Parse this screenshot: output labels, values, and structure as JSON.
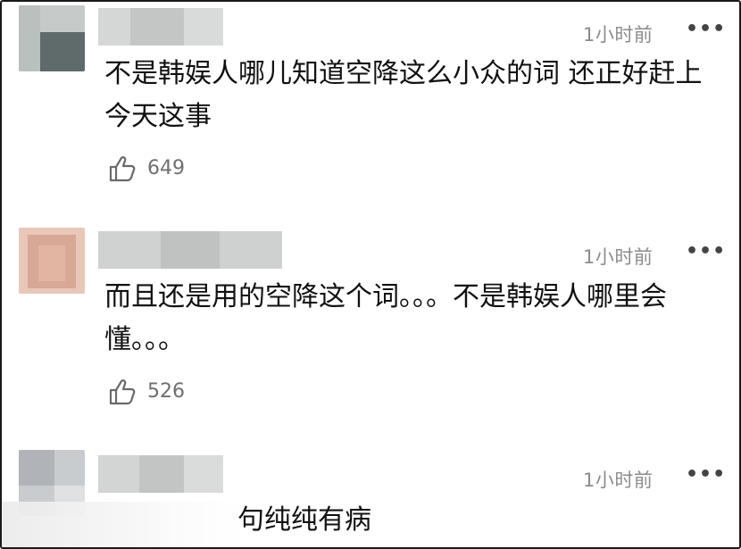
{
  "comments": [
    {
      "time": "1小时前",
      "more": "•••",
      "text": "不是韩娱人哪儿知道空降这么小众的词 还正好赶上今天这事",
      "likes": "649"
    },
    {
      "time": "1小时前",
      "more": "•••",
      "text": "而且还是用的空降这个词。。。不是韩娱人哪里会懂。。。",
      "likes": "526"
    },
    {
      "time": "1小时前",
      "more": "•••",
      "text": "句纯纯有病"
    }
  ],
  "icons": {
    "like": "thumbs-up-icon",
    "more": "more-dots-icon"
  }
}
